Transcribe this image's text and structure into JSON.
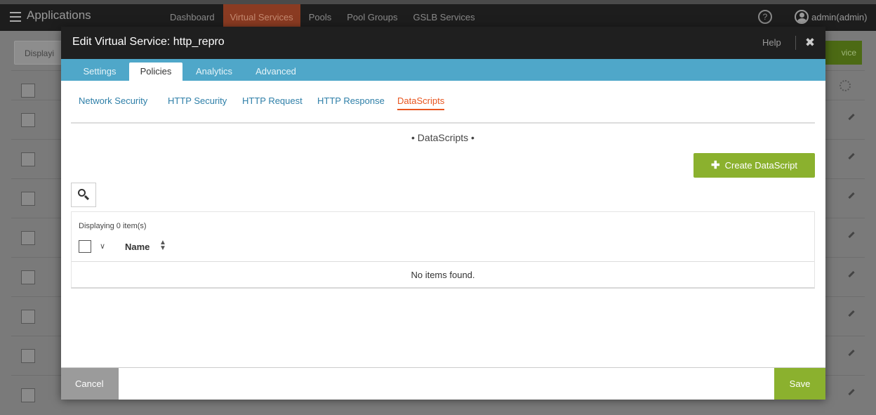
{
  "app": {
    "title": "Applications",
    "nav": [
      "Dashboard",
      "Virtual Services",
      "Pools",
      "Pool Groups",
      "GSLB Services"
    ],
    "active_nav": "Virtual Services",
    "help_symbol": "?",
    "user": "admin(admin)",
    "background_display_label": "Displayi",
    "background_create_label": "vice"
  },
  "modal": {
    "title": "Edit Virtual Service: http_repro",
    "help": "Help",
    "close_symbol": "✖",
    "tabs": [
      "Settings",
      "Policies",
      "Analytics",
      "Advanced"
    ],
    "active_tab": "Policies",
    "subtabs": [
      "Network Security",
      "HTTP Security",
      "HTTP Request",
      "HTTP Response",
      "DataScripts"
    ],
    "active_subtab": "DataScripts",
    "section_title": "• DataScripts •",
    "create_button": "Create DataScript",
    "grid": {
      "count": "Displaying 0 item(s)",
      "column_name": "Name",
      "empty": "No items found."
    },
    "cancel": "Cancel",
    "save": "Save"
  },
  "colors": {
    "accent_green": "#8bb12e",
    "tab_blue": "#4fa7c9",
    "active_subtab_orange": "#e8551f",
    "link_blue": "#2e7fa8"
  }
}
